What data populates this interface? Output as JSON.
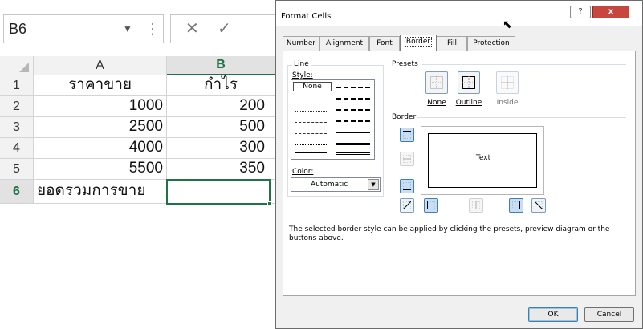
{
  "spreadsheet": {
    "name_box": "B6",
    "columns": [
      "A",
      "B"
    ],
    "rows": [
      {
        "num": "1",
        "a": "ราคาขาย",
        "b": "กำไร"
      },
      {
        "num": "2",
        "a": "1000",
        "b": "200"
      },
      {
        "num": "3",
        "a": "2500",
        "b": "500"
      },
      {
        "num": "4",
        "a": "4000",
        "b": "300"
      },
      {
        "num": "5",
        "a": "5500",
        "b": "350"
      },
      {
        "num": "6",
        "a": "ยอดรวมการขาย",
        "b": ""
      }
    ],
    "active_cell": "B6",
    "accent_color": "#217346"
  },
  "dialog": {
    "title": "Format Cells",
    "help": "?",
    "close": "x",
    "tabs": [
      "Number",
      "Alignment",
      "Font",
      "Border",
      "Fill",
      "Protection"
    ],
    "active_tab": "Border",
    "line": {
      "group": "Line",
      "style_label": "Style:",
      "none_option": "None",
      "color_label": "Color:",
      "color_value": "Automatic"
    },
    "presets": {
      "group": "Presets",
      "none": "None",
      "outline": "Outline",
      "inside": "Inside"
    },
    "border": {
      "group": "Border",
      "preview_text": "Text"
    },
    "description": "The selected border style can be applied by clicking the presets, preview diagram or the buttons above.",
    "ok": "OK",
    "cancel": "Cancel"
  }
}
